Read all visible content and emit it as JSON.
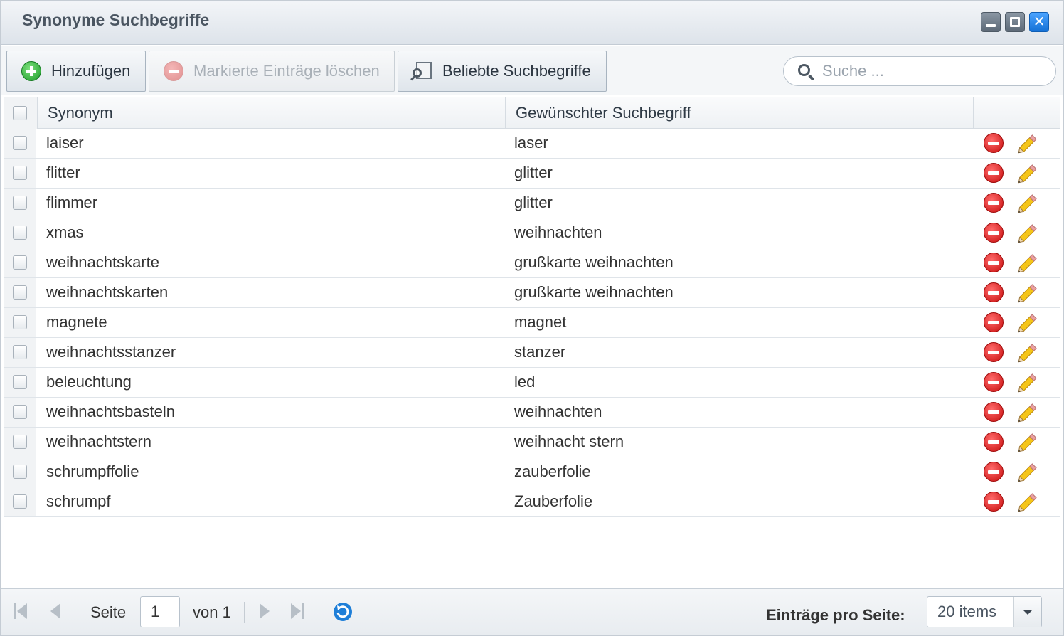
{
  "window": {
    "title": "Synonyme Suchbegriffe"
  },
  "toolbar": {
    "add_label": "Hinzufügen",
    "delete_marked_label": "Markierte Einträge löschen",
    "popular_label": "Beliebte Suchbegriffe",
    "search_placeholder": "Suche ..."
  },
  "grid": {
    "columns": [
      "Synonym",
      "Gewünschter Suchbegriff"
    ],
    "rows": [
      {
        "synonym": "laiser",
        "target": "laser"
      },
      {
        "synonym": "flitter",
        "target": "glitter"
      },
      {
        "synonym": "flimmer",
        "target": "glitter"
      },
      {
        "synonym": "xmas",
        "target": "weihnachten"
      },
      {
        "synonym": "weihnachtskarte",
        "target": "grußkarte weihnachten"
      },
      {
        "synonym": "weihnachtskarten",
        "target": "grußkarte weihnachten"
      },
      {
        "synonym": "magnete",
        "target": "magnet"
      },
      {
        "synonym": "weihnachtsstanzer",
        "target": "stanzer"
      },
      {
        "synonym": "beleuchtung",
        "target": "led"
      },
      {
        "synonym": "weihnachtsbasteln",
        "target": "weihnachten"
      },
      {
        "synonym": "weihnachtstern",
        "target": "weihnacht stern"
      },
      {
        "synonym": "schrumpffolie",
        "target": "zauberfolie"
      },
      {
        "synonym": "schrumpf",
        "target": "Zauberfolie"
      }
    ]
  },
  "pager": {
    "page_label": "Seite",
    "page_value": "1",
    "of_label": "von 1",
    "per_page_label": "Einträge pro Seite:",
    "per_page_value": "20 items"
  },
  "icons": {
    "add": "plus-circle-icon",
    "delete": "minus-circle-icon",
    "edit": "pencil-icon",
    "search": "magnifier-icon",
    "refresh": "refresh-icon"
  },
  "colors": {
    "delete_red": "#c80d0d",
    "add_green": "#1d9a2a",
    "close_blue": "#1571d6"
  }
}
